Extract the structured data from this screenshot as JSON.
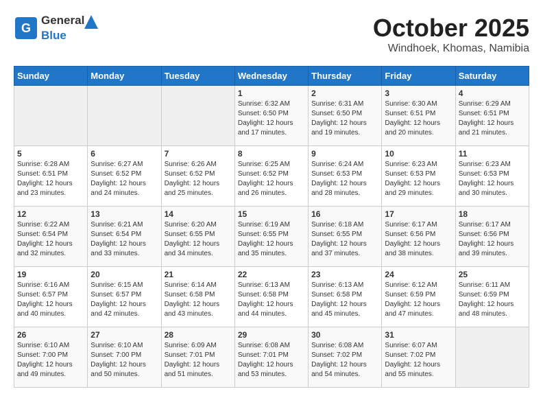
{
  "header": {
    "logo_general": "General",
    "logo_blue": "Blue",
    "month": "October 2025",
    "location": "Windhoek, Khomas, Namibia"
  },
  "weekdays": [
    "Sunday",
    "Monday",
    "Tuesday",
    "Wednesday",
    "Thursday",
    "Friday",
    "Saturday"
  ],
  "weeks": [
    [
      {
        "day": "",
        "info": ""
      },
      {
        "day": "",
        "info": ""
      },
      {
        "day": "",
        "info": ""
      },
      {
        "day": "1",
        "info": "Sunrise: 6:32 AM\nSunset: 6:50 PM\nDaylight: 12 hours\nand 17 minutes."
      },
      {
        "day": "2",
        "info": "Sunrise: 6:31 AM\nSunset: 6:50 PM\nDaylight: 12 hours\nand 19 minutes."
      },
      {
        "day": "3",
        "info": "Sunrise: 6:30 AM\nSunset: 6:51 PM\nDaylight: 12 hours\nand 20 minutes."
      },
      {
        "day": "4",
        "info": "Sunrise: 6:29 AM\nSunset: 6:51 PM\nDaylight: 12 hours\nand 21 minutes."
      }
    ],
    [
      {
        "day": "5",
        "info": "Sunrise: 6:28 AM\nSunset: 6:51 PM\nDaylight: 12 hours\nand 23 minutes."
      },
      {
        "day": "6",
        "info": "Sunrise: 6:27 AM\nSunset: 6:52 PM\nDaylight: 12 hours\nand 24 minutes."
      },
      {
        "day": "7",
        "info": "Sunrise: 6:26 AM\nSunset: 6:52 PM\nDaylight: 12 hours\nand 25 minutes."
      },
      {
        "day": "8",
        "info": "Sunrise: 6:25 AM\nSunset: 6:52 PM\nDaylight: 12 hours\nand 26 minutes."
      },
      {
        "day": "9",
        "info": "Sunrise: 6:24 AM\nSunset: 6:53 PM\nDaylight: 12 hours\nand 28 minutes."
      },
      {
        "day": "10",
        "info": "Sunrise: 6:23 AM\nSunset: 6:53 PM\nDaylight: 12 hours\nand 29 minutes."
      },
      {
        "day": "11",
        "info": "Sunrise: 6:23 AM\nSunset: 6:53 PM\nDaylight: 12 hours\nand 30 minutes."
      }
    ],
    [
      {
        "day": "12",
        "info": "Sunrise: 6:22 AM\nSunset: 6:54 PM\nDaylight: 12 hours\nand 32 minutes."
      },
      {
        "day": "13",
        "info": "Sunrise: 6:21 AM\nSunset: 6:54 PM\nDaylight: 12 hours\nand 33 minutes."
      },
      {
        "day": "14",
        "info": "Sunrise: 6:20 AM\nSunset: 6:55 PM\nDaylight: 12 hours\nand 34 minutes."
      },
      {
        "day": "15",
        "info": "Sunrise: 6:19 AM\nSunset: 6:55 PM\nDaylight: 12 hours\nand 35 minutes."
      },
      {
        "day": "16",
        "info": "Sunrise: 6:18 AM\nSunset: 6:55 PM\nDaylight: 12 hours\nand 37 minutes."
      },
      {
        "day": "17",
        "info": "Sunrise: 6:17 AM\nSunset: 6:56 PM\nDaylight: 12 hours\nand 38 minutes."
      },
      {
        "day": "18",
        "info": "Sunrise: 6:17 AM\nSunset: 6:56 PM\nDaylight: 12 hours\nand 39 minutes."
      }
    ],
    [
      {
        "day": "19",
        "info": "Sunrise: 6:16 AM\nSunset: 6:57 PM\nDaylight: 12 hours\nand 40 minutes."
      },
      {
        "day": "20",
        "info": "Sunrise: 6:15 AM\nSunset: 6:57 PM\nDaylight: 12 hours\nand 42 minutes."
      },
      {
        "day": "21",
        "info": "Sunrise: 6:14 AM\nSunset: 6:58 PM\nDaylight: 12 hours\nand 43 minutes."
      },
      {
        "day": "22",
        "info": "Sunrise: 6:13 AM\nSunset: 6:58 PM\nDaylight: 12 hours\nand 44 minutes."
      },
      {
        "day": "23",
        "info": "Sunrise: 6:13 AM\nSunset: 6:58 PM\nDaylight: 12 hours\nand 45 minutes."
      },
      {
        "day": "24",
        "info": "Sunrise: 6:12 AM\nSunset: 6:59 PM\nDaylight: 12 hours\nand 47 minutes."
      },
      {
        "day": "25",
        "info": "Sunrise: 6:11 AM\nSunset: 6:59 PM\nDaylight: 12 hours\nand 48 minutes."
      }
    ],
    [
      {
        "day": "26",
        "info": "Sunrise: 6:10 AM\nSunset: 7:00 PM\nDaylight: 12 hours\nand 49 minutes."
      },
      {
        "day": "27",
        "info": "Sunrise: 6:10 AM\nSunset: 7:00 PM\nDaylight: 12 hours\nand 50 minutes."
      },
      {
        "day": "28",
        "info": "Sunrise: 6:09 AM\nSunset: 7:01 PM\nDaylight: 12 hours\nand 51 minutes."
      },
      {
        "day": "29",
        "info": "Sunrise: 6:08 AM\nSunset: 7:01 PM\nDaylight: 12 hours\nand 53 minutes."
      },
      {
        "day": "30",
        "info": "Sunrise: 6:08 AM\nSunset: 7:02 PM\nDaylight: 12 hours\nand 54 minutes."
      },
      {
        "day": "31",
        "info": "Sunrise: 6:07 AM\nSunset: 7:02 PM\nDaylight: 12 hours\nand 55 minutes."
      },
      {
        "day": "",
        "info": ""
      }
    ]
  ]
}
